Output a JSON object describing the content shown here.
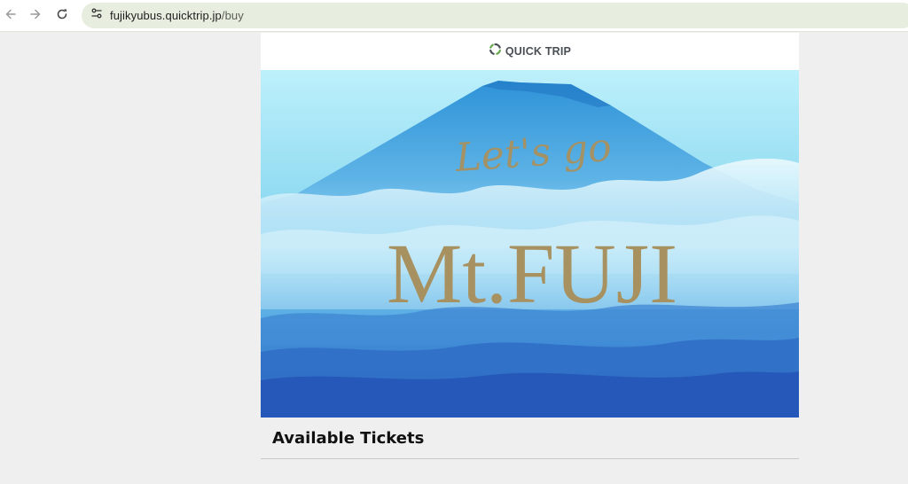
{
  "browser": {
    "url_host": "fujikyubus.quicktrip.jp",
    "url_path": "/buy"
  },
  "header": {
    "logo_text": "QUICK TRIP"
  },
  "hero": {
    "script_text": "Let's go",
    "title_text": "Mt.FUJI"
  },
  "main": {
    "section_title": "Available Tickets"
  },
  "colors": {
    "gold": "#a89160",
    "sky": "#7fd6f0",
    "deep_blue": "#2b63c0",
    "logo_green": "#6aa84f"
  }
}
